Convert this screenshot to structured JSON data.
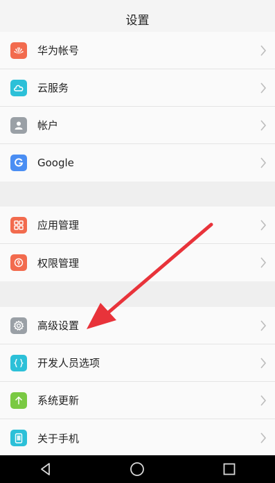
{
  "header": {
    "title": "设置"
  },
  "groups": {
    "account": [
      {
        "label": "华为帐号",
        "icon": "huawei-logo-icon",
        "color": "#f26b4e"
      },
      {
        "label": "云服务",
        "icon": "cloud-icon",
        "color": "#2cc0d8"
      },
      {
        "label": "帐户",
        "icon": "person-icon",
        "color": "#9aa0a6"
      },
      {
        "label": "Google",
        "icon": "google-g-icon",
        "color": "#4a8ef3"
      }
    ],
    "apps": [
      {
        "label": "应用管理",
        "icon": "app-grid-icon",
        "color": "#f26b4e"
      },
      {
        "label": "权限管理",
        "icon": "permission-icon",
        "color": "#f26b4e"
      }
    ],
    "system": [
      {
        "label": "高级设置",
        "icon": "gear-icon",
        "color": "#9aa0a6"
      },
      {
        "label": "开发人员选项",
        "icon": "braces-icon",
        "color": "#2cc0d8"
      },
      {
        "label": "系统更新",
        "icon": "update-arrow-icon",
        "color": "#7ac943"
      },
      {
        "label": "关于手机",
        "icon": "phone-icon",
        "color": "#2cc0d8"
      }
    ]
  },
  "navbar": {
    "back": "back-triangle-icon",
    "home": "home-circle-icon",
    "recents": "recents-square-icon"
  },
  "annotation": {
    "color": "#e8333a"
  }
}
